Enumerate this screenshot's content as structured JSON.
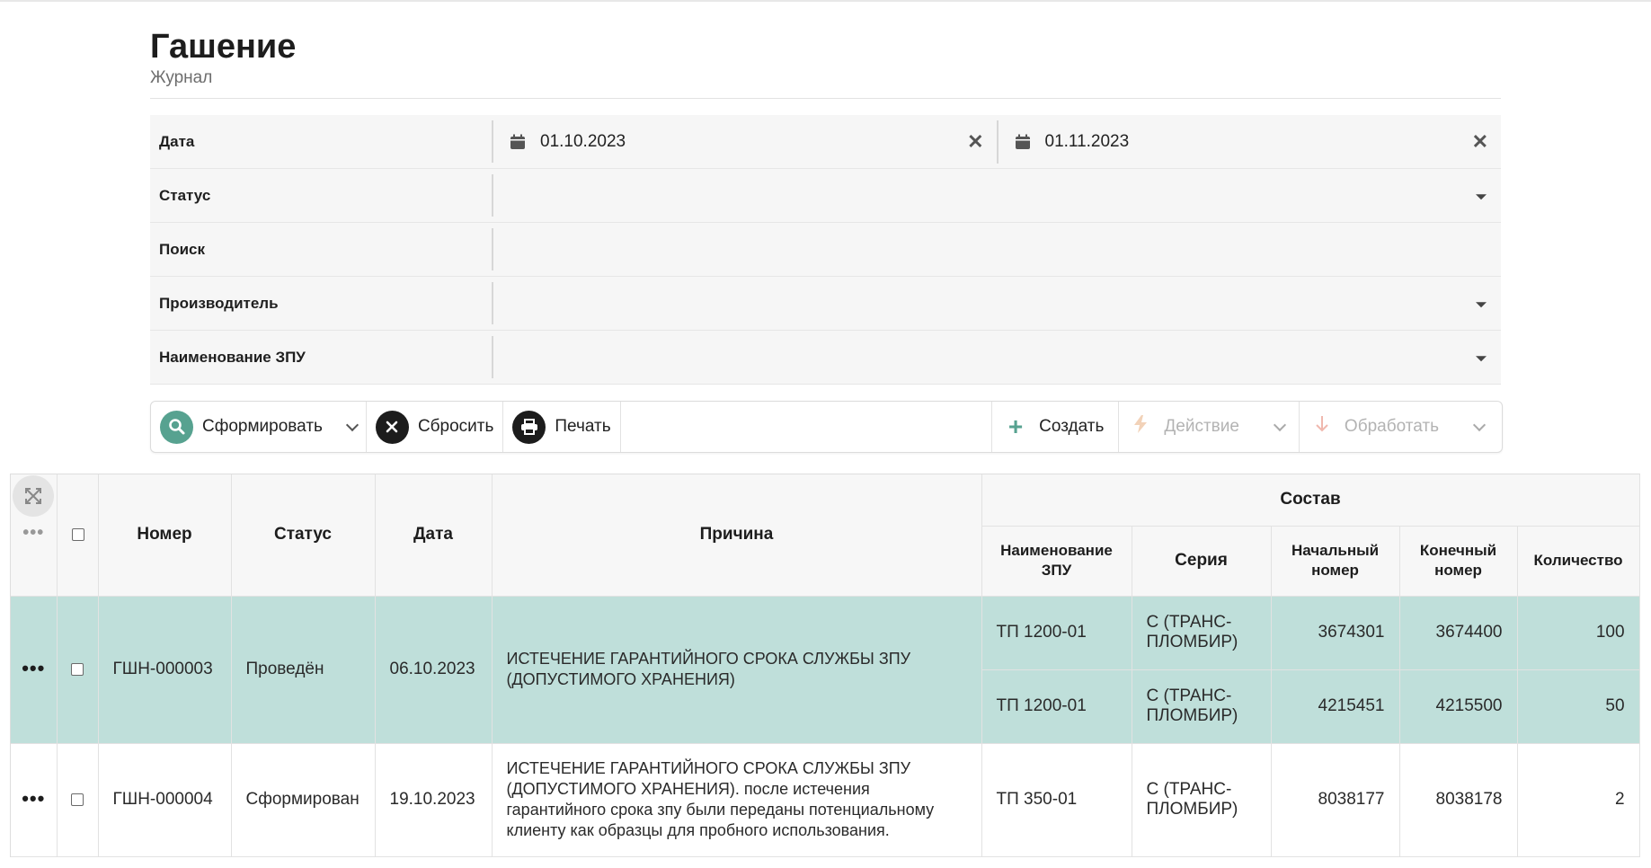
{
  "header": {
    "title": "Гашение",
    "subtitle": "Журнал"
  },
  "filters": {
    "date": {
      "label": "Дата",
      "from": "01.10.2023",
      "to": "01.11.2023"
    },
    "status": {
      "label": "Статус",
      "value": ""
    },
    "search": {
      "label": "Поиск",
      "value": ""
    },
    "manufacturer": {
      "label": "Производитель",
      "value": ""
    },
    "zpu_name": {
      "label": "Наименование ЗПУ",
      "value": ""
    }
  },
  "toolbar": {
    "generate_label": "Сформировать",
    "reset_label": "Сбросить",
    "print_label": "Печать",
    "create_label": "Создать",
    "action_label": "Действие",
    "process_label": "Обработать"
  },
  "table": {
    "headers": {
      "number": "Номер",
      "status": "Статус",
      "date": "Дата",
      "reason": "Причина",
      "composition": "Состав",
      "zpu_name": "Наименование ЗПУ",
      "series": "Серия",
      "start_number": "Начальный номер",
      "end_number": "Конечный номер",
      "quantity": "Количество"
    },
    "rows": [
      {
        "number": "ГШН-000003",
        "status": "Проведён",
        "date": "06.10.2023",
        "reason": "ИСТЕЧЕНИЕ ГАРАНТИЙНОГО СРОКА СЛУЖБЫ ЗПУ (ДОПУСТИМОГО ХРАНЕНИЯ)",
        "items": [
          {
            "zpu_name": "ТП 1200-01",
            "series": "С (ТРАНС-ПЛОМБИР)",
            "start": "3674301",
            "end": "3674400",
            "qty": "100"
          },
          {
            "zpu_name": "ТП 1200-01",
            "series": "С (ТРАНС-ПЛОМБИР)",
            "start": "4215451",
            "end": "4215500",
            "qty": "50"
          }
        ]
      },
      {
        "number": "ГШН-000004",
        "status": "Сформирован",
        "date": "19.10.2023",
        "reason": "ИСТЕЧЕНИЕ ГАРАНТИЙНОГО СРОКА СЛУЖБЫ ЗПУ (ДОПУСТИМОГО ХРАНЕНИЯ). после истечения гарантийного срока зпу были переданы потенциальному клиенту как образцы для пробного использования.",
        "items": [
          {
            "zpu_name": "ТП 350-01",
            "series": "С (ТРАНС-ПЛОМБИР)",
            "start": "8038177",
            "end": "8038178",
            "qty": "2"
          }
        ]
      }
    ]
  },
  "colors": {
    "accent": "#57a290",
    "selected_row": "#bfdfda",
    "dark_button": "#1c1c1c"
  }
}
